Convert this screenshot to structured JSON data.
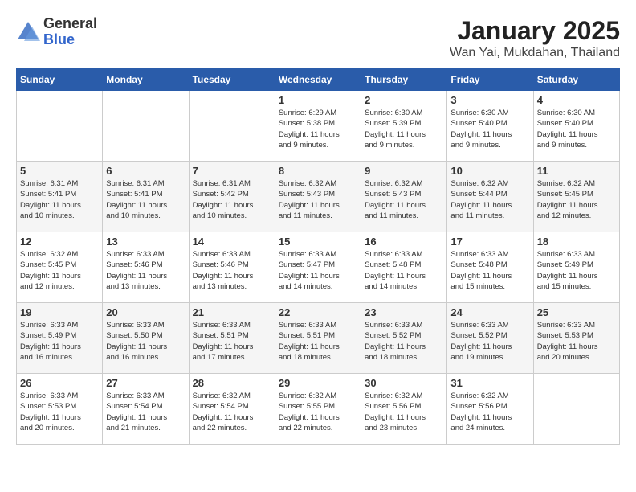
{
  "logo": {
    "general": "General",
    "blue": "Blue"
  },
  "title": "January 2025",
  "location": "Wan Yai, Mukdahan, Thailand",
  "headers": [
    "Sunday",
    "Monday",
    "Tuesday",
    "Wednesday",
    "Thursday",
    "Friday",
    "Saturday"
  ],
  "weeks": [
    [
      {
        "day": "",
        "info": ""
      },
      {
        "day": "",
        "info": ""
      },
      {
        "day": "",
        "info": ""
      },
      {
        "day": "1",
        "info": "Sunrise: 6:29 AM\nSunset: 5:38 PM\nDaylight: 11 hours\nand 9 minutes."
      },
      {
        "day": "2",
        "info": "Sunrise: 6:30 AM\nSunset: 5:39 PM\nDaylight: 11 hours\nand 9 minutes."
      },
      {
        "day": "3",
        "info": "Sunrise: 6:30 AM\nSunset: 5:40 PM\nDaylight: 11 hours\nand 9 minutes."
      },
      {
        "day": "4",
        "info": "Sunrise: 6:30 AM\nSunset: 5:40 PM\nDaylight: 11 hours\nand 9 minutes."
      }
    ],
    [
      {
        "day": "5",
        "info": "Sunrise: 6:31 AM\nSunset: 5:41 PM\nDaylight: 11 hours\nand 10 minutes."
      },
      {
        "day": "6",
        "info": "Sunrise: 6:31 AM\nSunset: 5:41 PM\nDaylight: 11 hours\nand 10 minutes."
      },
      {
        "day": "7",
        "info": "Sunrise: 6:31 AM\nSunset: 5:42 PM\nDaylight: 11 hours\nand 10 minutes."
      },
      {
        "day": "8",
        "info": "Sunrise: 6:32 AM\nSunset: 5:43 PM\nDaylight: 11 hours\nand 11 minutes."
      },
      {
        "day": "9",
        "info": "Sunrise: 6:32 AM\nSunset: 5:43 PM\nDaylight: 11 hours\nand 11 minutes."
      },
      {
        "day": "10",
        "info": "Sunrise: 6:32 AM\nSunset: 5:44 PM\nDaylight: 11 hours\nand 11 minutes."
      },
      {
        "day": "11",
        "info": "Sunrise: 6:32 AM\nSunset: 5:45 PM\nDaylight: 11 hours\nand 12 minutes."
      }
    ],
    [
      {
        "day": "12",
        "info": "Sunrise: 6:32 AM\nSunset: 5:45 PM\nDaylight: 11 hours\nand 12 minutes."
      },
      {
        "day": "13",
        "info": "Sunrise: 6:33 AM\nSunset: 5:46 PM\nDaylight: 11 hours\nand 13 minutes."
      },
      {
        "day": "14",
        "info": "Sunrise: 6:33 AM\nSunset: 5:46 PM\nDaylight: 11 hours\nand 13 minutes."
      },
      {
        "day": "15",
        "info": "Sunrise: 6:33 AM\nSunset: 5:47 PM\nDaylight: 11 hours\nand 14 minutes."
      },
      {
        "day": "16",
        "info": "Sunrise: 6:33 AM\nSunset: 5:48 PM\nDaylight: 11 hours\nand 14 minutes."
      },
      {
        "day": "17",
        "info": "Sunrise: 6:33 AM\nSunset: 5:48 PM\nDaylight: 11 hours\nand 15 minutes."
      },
      {
        "day": "18",
        "info": "Sunrise: 6:33 AM\nSunset: 5:49 PM\nDaylight: 11 hours\nand 15 minutes."
      }
    ],
    [
      {
        "day": "19",
        "info": "Sunrise: 6:33 AM\nSunset: 5:49 PM\nDaylight: 11 hours\nand 16 minutes."
      },
      {
        "day": "20",
        "info": "Sunrise: 6:33 AM\nSunset: 5:50 PM\nDaylight: 11 hours\nand 16 minutes."
      },
      {
        "day": "21",
        "info": "Sunrise: 6:33 AM\nSunset: 5:51 PM\nDaylight: 11 hours\nand 17 minutes."
      },
      {
        "day": "22",
        "info": "Sunrise: 6:33 AM\nSunset: 5:51 PM\nDaylight: 11 hours\nand 18 minutes."
      },
      {
        "day": "23",
        "info": "Sunrise: 6:33 AM\nSunset: 5:52 PM\nDaylight: 11 hours\nand 18 minutes."
      },
      {
        "day": "24",
        "info": "Sunrise: 6:33 AM\nSunset: 5:52 PM\nDaylight: 11 hours\nand 19 minutes."
      },
      {
        "day": "25",
        "info": "Sunrise: 6:33 AM\nSunset: 5:53 PM\nDaylight: 11 hours\nand 20 minutes."
      }
    ],
    [
      {
        "day": "26",
        "info": "Sunrise: 6:33 AM\nSunset: 5:53 PM\nDaylight: 11 hours\nand 20 minutes."
      },
      {
        "day": "27",
        "info": "Sunrise: 6:33 AM\nSunset: 5:54 PM\nDaylight: 11 hours\nand 21 minutes."
      },
      {
        "day": "28",
        "info": "Sunrise: 6:32 AM\nSunset: 5:54 PM\nDaylight: 11 hours\nand 22 minutes."
      },
      {
        "day": "29",
        "info": "Sunrise: 6:32 AM\nSunset: 5:55 PM\nDaylight: 11 hours\nand 22 minutes."
      },
      {
        "day": "30",
        "info": "Sunrise: 6:32 AM\nSunset: 5:56 PM\nDaylight: 11 hours\nand 23 minutes."
      },
      {
        "day": "31",
        "info": "Sunrise: 6:32 AM\nSunset: 5:56 PM\nDaylight: 11 hours\nand 24 minutes."
      },
      {
        "day": "",
        "info": ""
      }
    ]
  ]
}
